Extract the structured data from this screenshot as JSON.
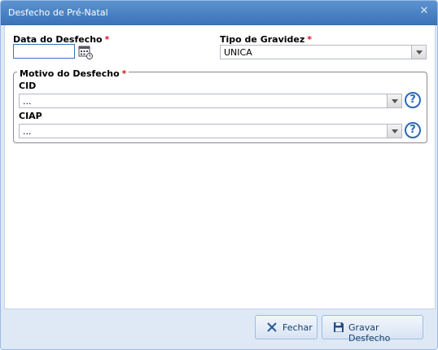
{
  "window": {
    "title": "Desfecho de Pré-Natal",
    "close_icon": "close-icon"
  },
  "form": {
    "date_label": "Data do Desfecho",
    "date_value": "",
    "required_mark": "*",
    "pregnancy_type_label": "Tipo de Gravidez",
    "pregnancy_type_value": "UNICA",
    "reason_legend": "Motivo do Desfecho",
    "cid_label": "CID",
    "cid_value": "...",
    "ciap_label": "CIAP",
    "ciap_value": "...",
    "help_glyph": "?"
  },
  "footer": {
    "close_label": "Fechar",
    "save_label": "Gravar Desfecho"
  },
  "colors": {
    "title_bar": "#3a73b8",
    "required": "#d21c1c",
    "help": "#2a6ab5",
    "footer_bg": "#dfe9f5"
  }
}
